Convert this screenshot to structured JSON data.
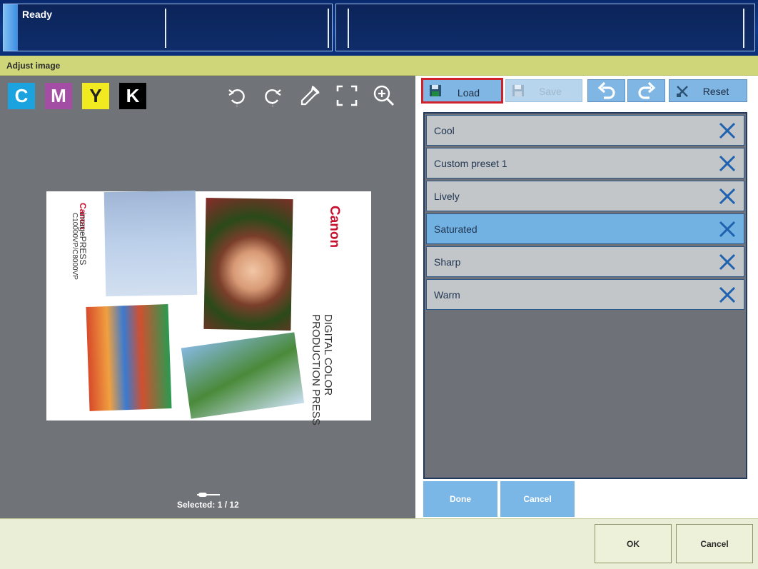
{
  "status": {
    "text": "Ready"
  },
  "window": {
    "title": "Adjust image"
  },
  "channels": [
    "C",
    "M",
    "Y",
    "K"
  ],
  "tools": [
    "rotate-left-icon",
    "rotate-right-icon",
    "eyedropper-icon",
    "fit-to-screen-icon",
    "zoom-in-icon"
  ],
  "document": {
    "brand": "Canon",
    "product": "imagePRESS",
    "model": "C10000VP/C8000VP",
    "headline_1": "DIGITAL COLOR",
    "headline_2": "PRODUCTION PRESS"
  },
  "preview": {
    "selected": "Selected: 1 / 12"
  },
  "toolbar": {
    "load": "Load",
    "save": "Save",
    "reset": "Reset"
  },
  "presets": [
    {
      "name": "Cool",
      "selected": false
    },
    {
      "name": "Custom preset 1",
      "selected": false
    },
    {
      "name": "Lively",
      "selected": false
    },
    {
      "name": "Saturated",
      "selected": true
    },
    {
      "name": "Sharp",
      "selected": false
    },
    {
      "name": "Warm",
      "selected": false
    }
  ],
  "panel_buttons": {
    "done": "Done",
    "cancel": "Cancel"
  },
  "footer": {
    "ok": "OK",
    "cancel": "Cancel"
  },
  "colors": {
    "accent": "#72b2e3",
    "highlight": "#d0202a",
    "title_bar": "#cfd67a"
  }
}
